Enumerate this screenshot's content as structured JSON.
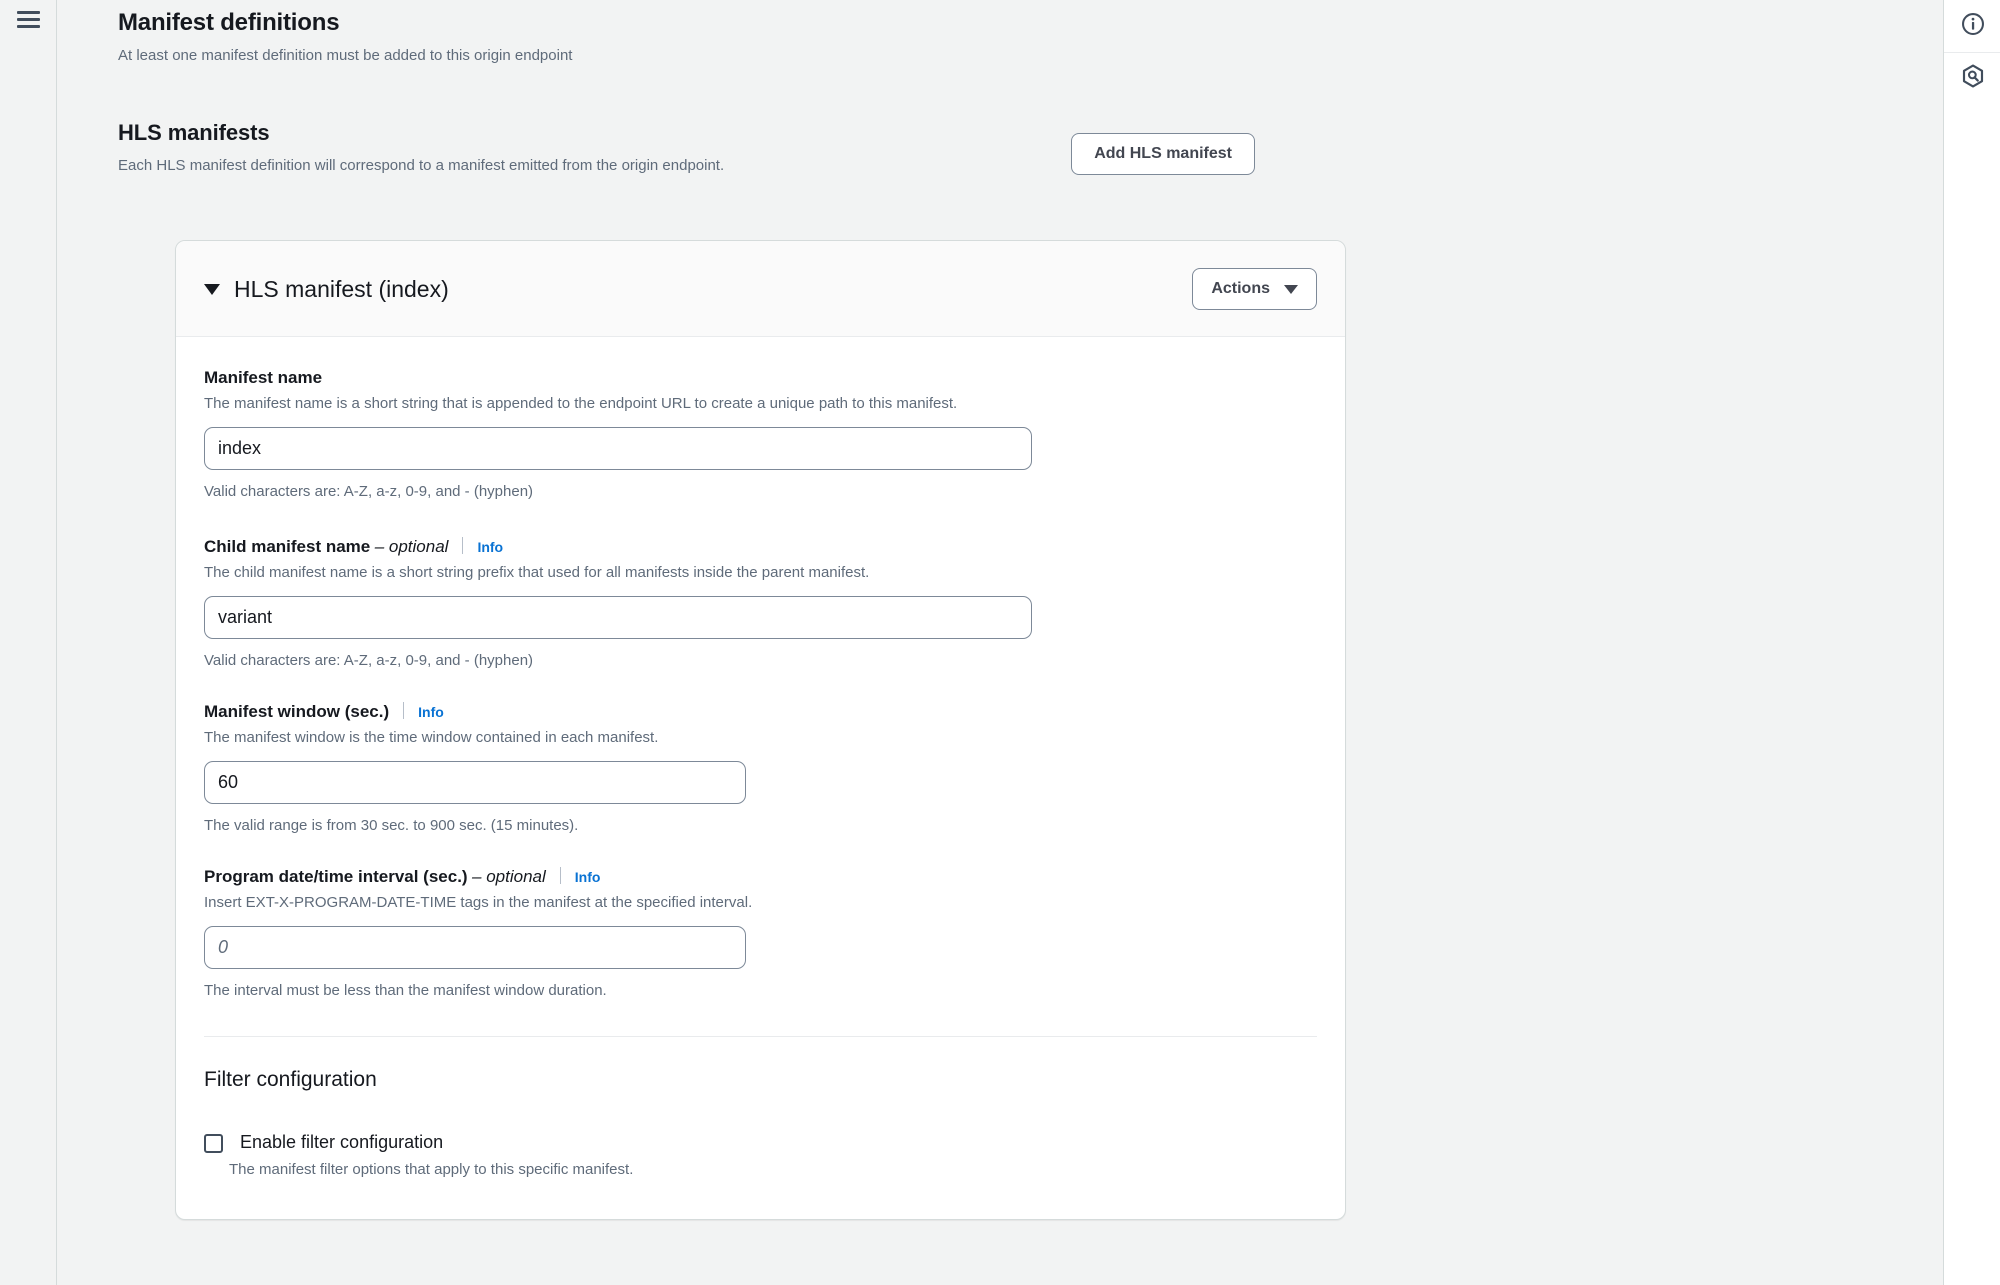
{
  "page": {
    "title": "Manifest definitions",
    "description": "At least one manifest definition must be added to this origin endpoint"
  },
  "section": {
    "title": "HLS manifests",
    "description": "Each HLS manifest definition will correspond to a manifest emitted from the origin endpoint.",
    "add_button": "Add HLS manifest"
  },
  "card": {
    "title": "HLS manifest (index)",
    "actions_button": "Actions",
    "fields": {
      "manifest_name": {
        "label": "Manifest name",
        "description": "The manifest name is a short string that is appended to the endpoint URL to create a unique path to this manifest.",
        "value": "index",
        "constraint": "Valid characters are: A-Z, a-z, 0-9, and - (hyphen)"
      },
      "child_manifest_name": {
        "label": "Child manifest name",
        "optional": "– optional",
        "info": "Info",
        "description": "The child manifest name is a short string prefix that used for all manifests inside the parent manifest.",
        "value": "variant",
        "constraint": "Valid characters are: A-Z, a-z, 0-9, and - (hyphen)"
      },
      "manifest_window": {
        "label": "Manifest window (sec.)",
        "info": "Info",
        "description": "The manifest window is the time window contained in each manifest.",
        "value": "60",
        "constraint": "The valid range is from 30 sec. to 900 sec. (15 minutes)."
      },
      "program_date_time_interval": {
        "label": "Program date/time interval (sec.)",
        "optional": "– optional",
        "info": "Info",
        "description": "Insert EXT-X-PROGRAM-DATE-TIME tags in the manifest at the specified interval.",
        "value": "",
        "placeholder": "0",
        "constraint": "The interval must be less than the manifest window duration."
      }
    },
    "filter_configuration": {
      "title": "Filter configuration",
      "checkbox_label": "Enable filter configuration",
      "checkbox_description": "The manifest filter options that apply to this specific manifest.",
      "checked": false
    }
  },
  "rails": {
    "menu_icon": "hamburger-menu-icon",
    "info_icon": "info-circle-icon",
    "assistant_icon": "q-assistant-icon"
  },
  "colors": {
    "accent_link": "#0972d3",
    "page_bg": "#f2f3f3",
    "card_bg": "#ffffff",
    "border": "#d5dbdb",
    "text_primary": "#16191f",
    "text_secondary": "#5f6b7a"
  }
}
